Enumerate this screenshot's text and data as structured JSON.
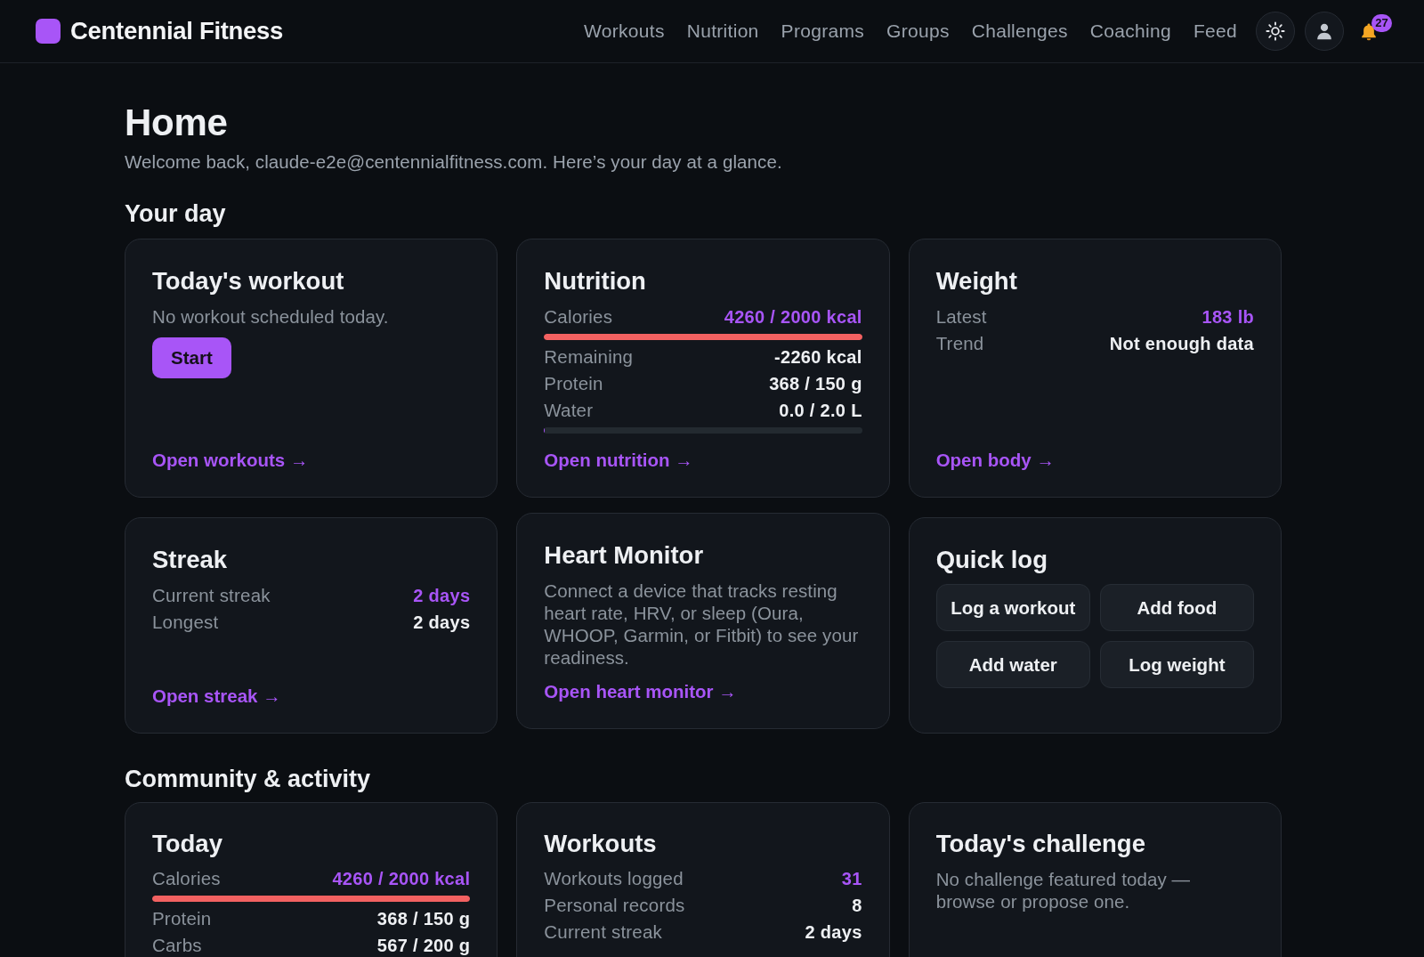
{
  "header": {
    "brand": "Centennial Fitness",
    "nav": [
      {
        "label": "Workouts"
      },
      {
        "label": "Nutrition"
      },
      {
        "label": "Programs"
      },
      {
        "label": "Groups"
      },
      {
        "label": "Challenges"
      },
      {
        "label": "Coaching"
      },
      {
        "label": "Feed"
      }
    ],
    "notifications": {
      "count": "27"
    }
  },
  "page": {
    "title": "Home",
    "subtitle": "Welcome back, claude-e2e@centennialfitness.com. Here’s your day at a glance."
  },
  "sections": [
    {
      "heading": "Your day",
      "cards": [
        {
          "title": "Today's workout",
          "text": "No workout scheduled today.",
          "button": "Start",
          "link": "Open workouts →"
        },
        {
          "title": "Nutrition",
          "items": [
            {
              "kind": "row",
              "label": "Calories",
              "value": "4260 / 2000 kcal",
              "highlight": true
            },
            {
              "kind": "meter",
              "level": 1,
              "over": true
            },
            {
              "kind": "row",
              "label": "Remaining",
              "value": "-2260 kcal",
              "highlight": false
            },
            {
              "kind": "row",
              "label": "Protein",
              "value": "368 / 150 g",
              "highlight": false
            },
            {
              "kind": "row",
              "label": "Water",
              "value": "0.0 / 2.0 L",
              "highlight": false
            },
            {
              "kind": "meter",
              "level": 0,
              "over": false
            }
          ],
          "link": "Open nutrition →"
        },
        {
          "title": "Weight",
          "items": [
            {
              "kind": "row",
              "label": "Latest",
              "value": "183 lb",
              "highlight": true
            },
            {
              "kind": "row",
              "label": "Trend",
              "value": "Not enough data",
              "highlight": false
            }
          ],
          "link": "Open body →"
        },
        {
          "title": "Streak",
          "items": [
            {
              "kind": "row",
              "label": "Current streak",
              "value": "2 days",
              "highlight": true
            },
            {
              "kind": "row",
              "label": "Longest",
              "value": "2 days",
              "highlight": false
            }
          ],
          "link": "Open streak →"
        },
        {
          "title": "Heart Monitor",
          "text": "Connect a device that tracks resting heart rate, HRV, or sleep (Oura, WHOOP, Garmin, or Fitbit) to see your readiness.",
          "link": "Open heart monitor →"
        },
        {
          "title": "Quick log",
          "actions": [
            "Log a workout",
            "Add food",
            "Add water",
            "Log weight"
          ]
        }
      ]
    },
    {
      "heading": "Community & activity",
      "cards": [
        {
          "title": "Today",
          "items": [
            {
              "kind": "row",
              "label": "Calories",
              "value": "4260 / 2000 kcal",
              "highlight": true
            },
            {
              "kind": "meter",
              "level": 1,
              "over": true
            },
            {
              "kind": "row",
              "label": "Protein",
              "value": "368 / 150 g",
              "highlight": false
            },
            {
              "kind": "row",
              "label": "Carbs",
              "value": "567 / 200 g",
              "highlight": false
            }
          ]
        },
        {
          "title": "Workouts",
          "items": [
            {
              "kind": "row",
              "label": "Workouts logged",
              "value": "31",
              "highlight": true
            },
            {
              "kind": "row",
              "label": "Personal records",
              "value": "8",
              "highlight": false
            },
            {
              "kind": "row",
              "label": "Current streak",
              "value": "2 days",
              "highlight": false
            }
          ]
        },
        {
          "title": "Today's challenge",
          "text": "No challenge featured today — browse or propose one."
        }
      ]
    }
  ]
}
